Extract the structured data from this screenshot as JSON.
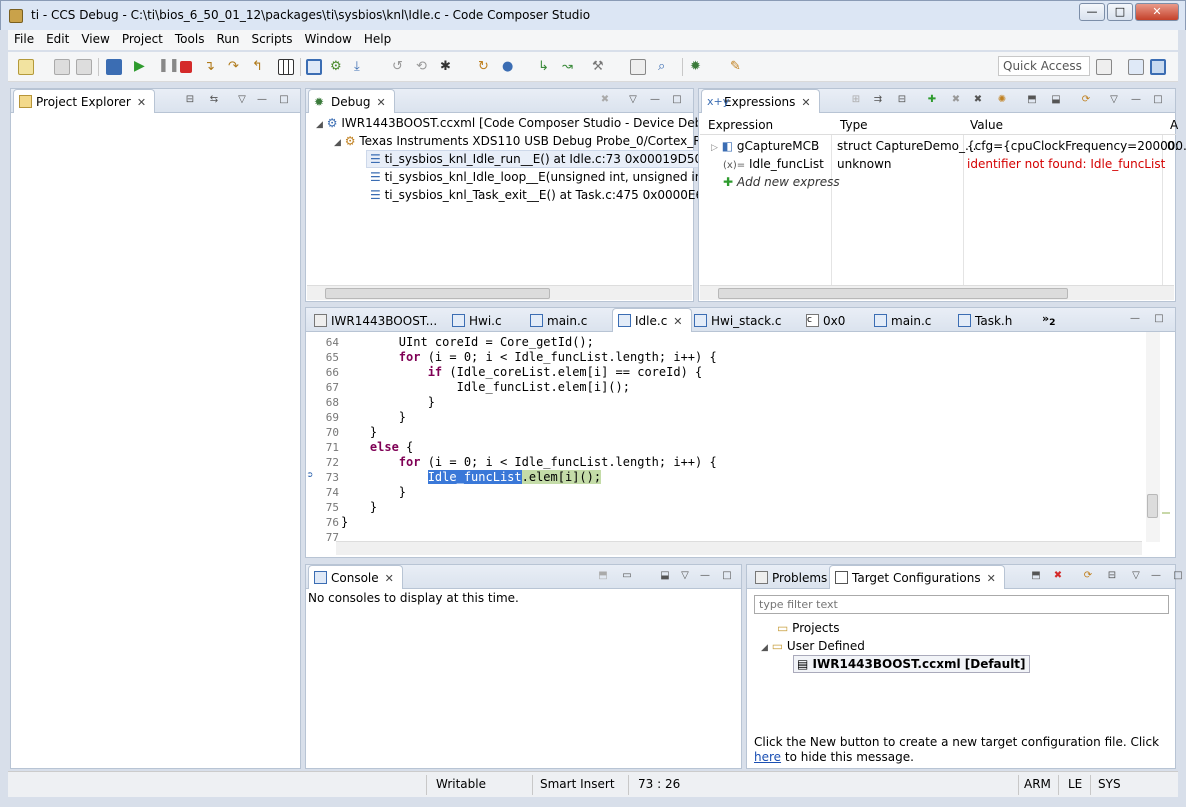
{
  "window": {
    "title": "ti - CCS Debug - C:\\ti\\bios_6_50_01_12\\packages\\ti\\sysbios\\knl\\Idle.c - Code Composer Studio",
    "min": "—",
    "max": "□",
    "close": "✕"
  },
  "menu": [
    "File",
    "Edit",
    "View",
    "Project",
    "Tools",
    "Run",
    "Scripts",
    "Window",
    "Help"
  ],
  "toolbar": {
    "quick_access": "Quick Access"
  },
  "project_explorer": {
    "title": "Project Explorer"
  },
  "debug": {
    "title": "Debug",
    "items": [
      "IWR1443BOOST.ccxml [Code Composer Studio - Device Debuggi",
      "Texas Instruments XDS110 USB Debug Probe_0/Cortex_R4_0 (S",
      "ti_sysbios_knl_Idle_run__E() at Idle.c:73 0x00019D50",
      "ti_sysbios_knl_Idle_loop__E(unsigned int, unsigned int)() at",
      "ti_sysbios_knl_Task_exit__E() at Task.c:475 0x0000E6C0  (ne"
    ]
  },
  "expressions": {
    "title": "Expressions",
    "headers": [
      "Expression",
      "Type",
      "Value",
      "A"
    ],
    "rows": [
      {
        "expr": "gCaptureMCB",
        "type": "struct CaptureDemo_...",
        "value": "{cfg={cpuClockFrequency=200000...",
        "extra": "0:"
      },
      {
        "expr": "Idle_funcList",
        "type": "unknown",
        "value": "identifier not found: Idle_funcList",
        "extra": ""
      }
    ],
    "add": "Add new express",
    "value_error_color": "#d40000"
  },
  "editor": {
    "tabs": [
      "IWR1443BOOST...",
      "Hwi.c",
      "main.c",
      "Idle.c",
      "Hwi_stack.c",
      "0x0",
      "main.c",
      "Task.h"
    ],
    "overflow": "2",
    "lines": [
      {
        "n": "64",
        "code": "        UInt coreId = Core_getId();"
      },
      {
        "n": "65",
        "code": "        for (i = 0; i < Idle_funcList.length; i++) {"
      },
      {
        "n": "66",
        "code": "            if (Idle_coreList.elem[i] == coreId) {"
      },
      {
        "n": "67",
        "code": "                Idle_funcList.elem[i]();"
      },
      {
        "n": "68",
        "code": "            }"
      },
      {
        "n": "69",
        "code": "        }"
      },
      {
        "n": "70",
        "code": "    }"
      },
      {
        "n": "71",
        "code": "    else {"
      },
      {
        "n": "72",
        "code": "        for (i = 0; i < Idle_funcList.length; i++) {"
      },
      {
        "n": "73",
        "code": "            Idle_funcList.elem[i]();"
      },
      {
        "n": "74",
        "code": "        }"
      },
      {
        "n": "75",
        "code": "    }"
      },
      {
        "n": "76",
        "code": "}"
      },
      {
        "n": "77",
        "code": ""
      }
    ],
    "current_line": "73",
    "selected": "Idle_funcList"
  },
  "console": {
    "title": "Console",
    "message": "No consoles to display at this time."
  },
  "problems": {
    "title": "Problems"
  },
  "target": {
    "title": "Target Configurations",
    "filter_placeholder": "type filter text",
    "tree": [
      "Projects",
      "User Defined",
      "IWR1443BOOST.ccxml [Default]"
    ],
    "help_pre": "Click the New button to create a new target configuration file. Click ",
    "help_link": "here",
    "help_post": " to hide this message."
  },
  "status": {
    "mode": "Writable",
    "insert": "Smart Insert",
    "pos": "73 : 26",
    "arch": "ARM",
    "endian": "LE",
    "sys": "SYS"
  }
}
